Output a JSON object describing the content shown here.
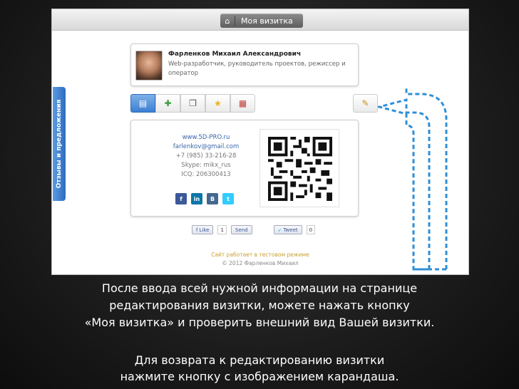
{
  "site": {
    "topbar": {
      "home_icon": "home-icon",
      "button_label": "Моя визитка"
    },
    "profile": {
      "name": "Фарленков Михаил Александрович",
      "description": "Web-разработчик, руководитель проектов, режиссер и оператор"
    },
    "tabs": [
      {
        "icon": "contact-card-icon",
        "glyph": "▤"
      },
      {
        "icon": "add-user-icon",
        "glyph": "✚"
      },
      {
        "icon": "copy-icon",
        "glyph": "❐"
      },
      {
        "icon": "star-icon",
        "glyph": "★"
      },
      {
        "icon": "calendar-icon",
        "glyph": "▦"
      }
    ],
    "edit_icon": "pencil-icon",
    "contacts": {
      "website": "www.5D-PRO.ru",
      "email": "farlenkov@gmail.com",
      "phone": "+7 (985) 33-216-28",
      "skype": "Skype: mikx_rus",
      "icq": "ICQ: 206300413"
    },
    "socials": [
      {
        "name": "facebook",
        "letter": "f",
        "color": "#3b5998"
      },
      {
        "name": "linkedin",
        "letter": "in",
        "color": "#0e76a8"
      },
      {
        "name": "vkontakte",
        "letter": "B",
        "color": "#45688e"
      },
      {
        "name": "twitter",
        "letter": "t",
        "color": "#33ccff"
      }
    ],
    "like": {
      "label": "Like",
      "count": "1",
      "send": "Send"
    },
    "tweet": {
      "label": "Tweet",
      "count": "0"
    },
    "test_note": "Сайт работает в тестовом режиме",
    "copyright": "© 2012 Фарленков Михаил",
    "feedback_tab": "Отзывы и предложения"
  },
  "caption": {
    "line1": "После ввода всей нужной информации на странице",
    "line2": "редактирования визитки, можете нажать кнопку",
    "line3": "«Моя визитка» и проверить внешний вид Вашей визитки.",
    "line4": "Для возврата к редактированию визитки",
    "line5": "нажмите кнопку с изображением карандаша."
  },
  "colors": {
    "accent": "#3b7fd3",
    "arrow": "#2f8fd6"
  }
}
